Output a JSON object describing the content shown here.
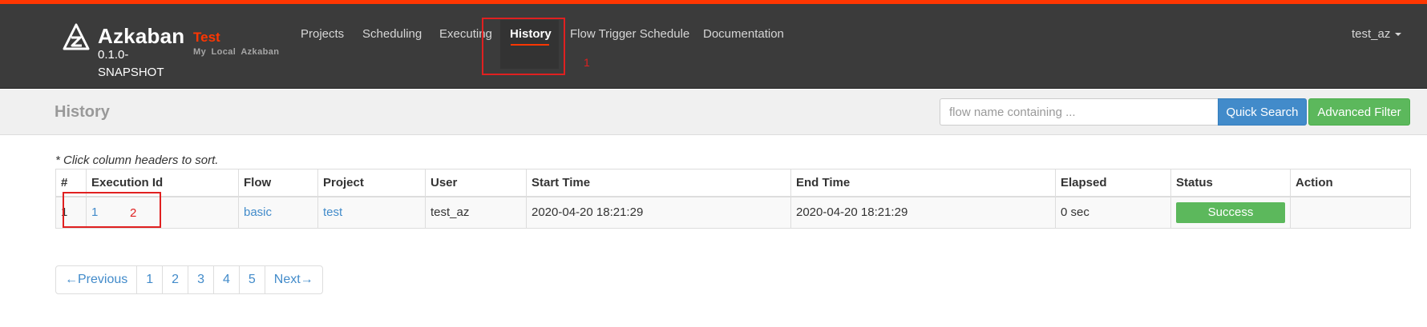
{
  "brand": {
    "name": "Azkaban",
    "version": "0.1.0-SNAPSHOT",
    "environment": "Test",
    "environment_description": "My Local Azkaban"
  },
  "nav": {
    "items": [
      {
        "label": "Projects",
        "active": false
      },
      {
        "label": "Scheduling",
        "active": false
      },
      {
        "label": "Executing",
        "active": false
      },
      {
        "label": "History",
        "active": true
      },
      {
        "label": "Flow Trigger Schedule",
        "active": false
      },
      {
        "label": "Documentation",
        "active": false
      }
    ],
    "user": "test_az"
  },
  "annotations": [
    "1",
    "2"
  ],
  "page": {
    "title": "History",
    "search_placeholder": "flow name containing ...",
    "quick_search_label": "Quick Search",
    "advanced_filter_label": "Advanced Filter",
    "sort_hint": "* Click column headers to sort."
  },
  "table": {
    "headers": [
      "#",
      "Execution Id",
      "Flow",
      "Project",
      "User",
      "Start Time",
      "End Time",
      "Elapsed",
      "Status",
      "Action"
    ],
    "rows": [
      {
        "index": "1",
        "execution_id": "1",
        "flow": "basic",
        "project": "test",
        "user": "test_az",
        "start_time": "2020-04-20 18:21:29",
        "end_time": "2020-04-20 18:21:29",
        "elapsed": "0 sec",
        "status": "Success",
        "action": ""
      }
    ]
  },
  "pagination": {
    "previous": "←Previous",
    "pages": [
      "1",
      "2",
      "3",
      "4",
      "5"
    ],
    "next": "Next→"
  },
  "colors": {
    "accent": "#ff3601",
    "navbar": "#3b3b3b",
    "primary": "#428bca",
    "success": "#5cb85c",
    "annotation": "#e02020"
  }
}
